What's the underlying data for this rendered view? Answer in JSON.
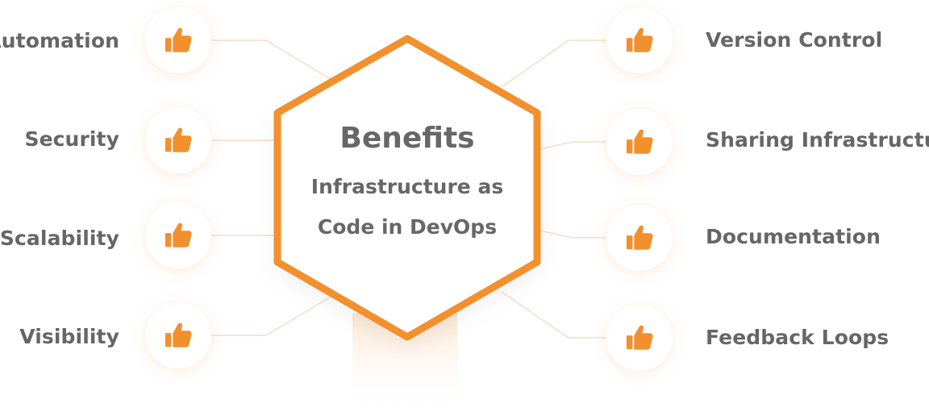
{
  "center": {
    "title": "Benefits",
    "subtitle_line1": "Infrastructure as",
    "subtitle_line2": "Code in DevOps"
  },
  "left_benefits": [
    "Automation",
    "Security",
    "Scalability",
    "Visibility"
  ],
  "right_benefits": [
    "Version Control",
    "Sharing Infrastructure",
    "Documentation",
    "Feedback Loops"
  ],
  "icon": "thumbs-up-icon",
  "colors": {
    "accent": "#F2902E",
    "text": "#666666",
    "connector": "#F8DCC6"
  }
}
